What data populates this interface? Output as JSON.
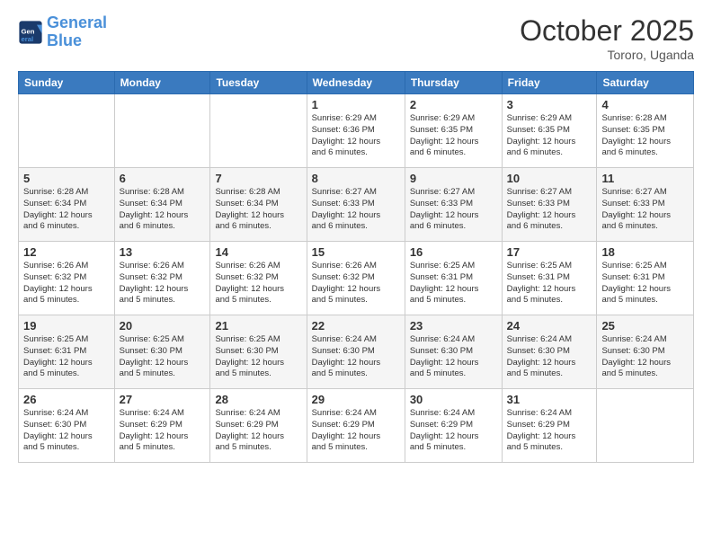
{
  "logo": {
    "line1": "General",
    "line2": "Blue"
  },
  "title": "October 2025",
  "location": "Tororo, Uganda",
  "weekdays": [
    "Sunday",
    "Monday",
    "Tuesday",
    "Wednesday",
    "Thursday",
    "Friday",
    "Saturday"
  ],
  "weeks": [
    [
      {
        "day": "",
        "info": ""
      },
      {
        "day": "",
        "info": ""
      },
      {
        "day": "",
        "info": ""
      },
      {
        "day": "1",
        "info": "Sunrise: 6:29 AM\nSunset: 6:36 PM\nDaylight: 12 hours\nand 6 minutes."
      },
      {
        "day": "2",
        "info": "Sunrise: 6:29 AM\nSunset: 6:35 PM\nDaylight: 12 hours\nand 6 minutes."
      },
      {
        "day": "3",
        "info": "Sunrise: 6:29 AM\nSunset: 6:35 PM\nDaylight: 12 hours\nand 6 minutes."
      },
      {
        "day": "4",
        "info": "Sunrise: 6:28 AM\nSunset: 6:35 PM\nDaylight: 12 hours\nand 6 minutes."
      }
    ],
    [
      {
        "day": "5",
        "info": "Sunrise: 6:28 AM\nSunset: 6:34 PM\nDaylight: 12 hours\nand 6 minutes."
      },
      {
        "day": "6",
        "info": "Sunrise: 6:28 AM\nSunset: 6:34 PM\nDaylight: 12 hours\nand 6 minutes."
      },
      {
        "day": "7",
        "info": "Sunrise: 6:28 AM\nSunset: 6:34 PM\nDaylight: 12 hours\nand 6 minutes."
      },
      {
        "day": "8",
        "info": "Sunrise: 6:27 AM\nSunset: 6:33 PM\nDaylight: 12 hours\nand 6 minutes."
      },
      {
        "day": "9",
        "info": "Sunrise: 6:27 AM\nSunset: 6:33 PM\nDaylight: 12 hours\nand 6 minutes."
      },
      {
        "day": "10",
        "info": "Sunrise: 6:27 AM\nSunset: 6:33 PM\nDaylight: 12 hours\nand 6 minutes."
      },
      {
        "day": "11",
        "info": "Sunrise: 6:27 AM\nSunset: 6:33 PM\nDaylight: 12 hours\nand 6 minutes."
      }
    ],
    [
      {
        "day": "12",
        "info": "Sunrise: 6:26 AM\nSunset: 6:32 PM\nDaylight: 12 hours\nand 5 minutes."
      },
      {
        "day": "13",
        "info": "Sunrise: 6:26 AM\nSunset: 6:32 PM\nDaylight: 12 hours\nand 5 minutes."
      },
      {
        "day": "14",
        "info": "Sunrise: 6:26 AM\nSunset: 6:32 PM\nDaylight: 12 hours\nand 5 minutes."
      },
      {
        "day": "15",
        "info": "Sunrise: 6:26 AM\nSunset: 6:32 PM\nDaylight: 12 hours\nand 5 minutes."
      },
      {
        "day": "16",
        "info": "Sunrise: 6:25 AM\nSunset: 6:31 PM\nDaylight: 12 hours\nand 5 minutes."
      },
      {
        "day": "17",
        "info": "Sunrise: 6:25 AM\nSunset: 6:31 PM\nDaylight: 12 hours\nand 5 minutes."
      },
      {
        "day": "18",
        "info": "Sunrise: 6:25 AM\nSunset: 6:31 PM\nDaylight: 12 hours\nand 5 minutes."
      }
    ],
    [
      {
        "day": "19",
        "info": "Sunrise: 6:25 AM\nSunset: 6:31 PM\nDaylight: 12 hours\nand 5 minutes."
      },
      {
        "day": "20",
        "info": "Sunrise: 6:25 AM\nSunset: 6:30 PM\nDaylight: 12 hours\nand 5 minutes."
      },
      {
        "day": "21",
        "info": "Sunrise: 6:25 AM\nSunset: 6:30 PM\nDaylight: 12 hours\nand 5 minutes."
      },
      {
        "day": "22",
        "info": "Sunrise: 6:24 AM\nSunset: 6:30 PM\nDaylight: 12 hours\nand 5 minutes."
      },
      {
        "day": "23",
        "info": "Sunrise: 6:24 AM\nSunset: 6:30 PM\nDaylight: 12 hours\nand 5 minutes."
      },
      {
        "day": "24",
        "info": "Sunrise: 6:24 AM\nSunset: 6:30 PM\nDaylight: 12 hours\nand 5 minutes."
      },
      {
        "day": "25",
        "info": "Sunrise: 6:24 AM\nSunset: 6:30 PM\nDaylight: 12 hours\nand 5 minutes."
      }
    ],
    [
      {
        "day": "26",
        "info": "Sunrise: 6:24 AM\nSunset: 6:30 PM\nDaylight: 12 hours\nand 5 minutes."
      },
      {
        "day": "27",
        "info": "Sunrise: 6:24 AM\nSunset: 6:29 PM\nDaylight: 12 hours\nand 5 minutes."
      },
      {
        "day": "28",
        "info": "Sunrise: 6:24 AM\nSunset: 6:29 PM\nDaylight: 12 hours\nand 5 minutes."
      },
      {
        "day": "29",
        "info": "Sunrise: 6:24 AM\nSunset: 6:29 PM\nDaylight: 12 hours\nand 5 minutes."
      },
      {
        "day": "30",
        "info": "Sunrise: 6:24 AM\nSunset: 6:29 PM\nDaylight: 12 hours\nand 5 minutes."
      },
      {
        "day": "31",
        "info": "Sunrise: 6:24 AM\nSunset: 6:29 PM\nDaylight: 12 hours\nand 5 minutes."
      },
      {
        "day": "",
        "info": ""
      }
    ]
  ]
}
